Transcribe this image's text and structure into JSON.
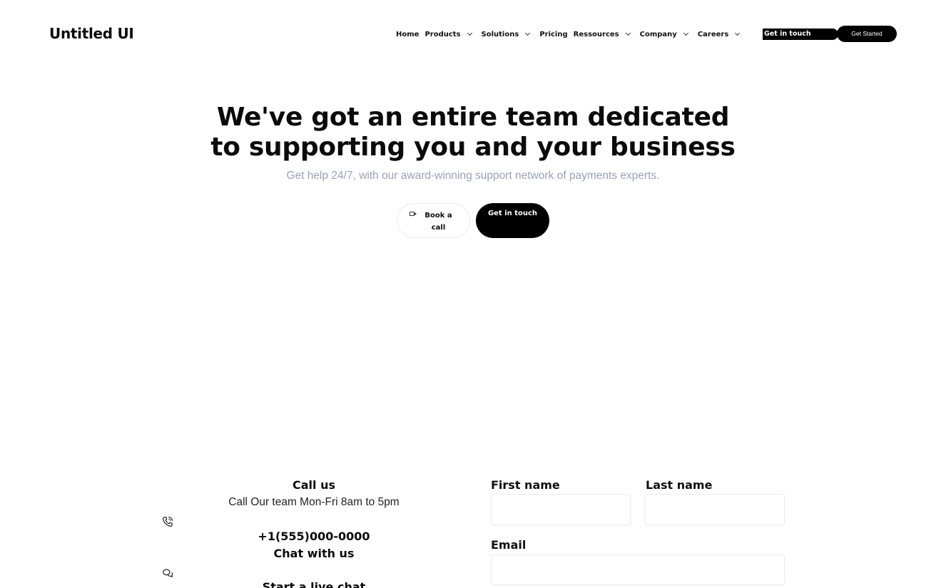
{
  "brand": {
    "name": "Untitled UI"
  },
  "nav": {
    "items": [
      {
        "label": "Home",
        "dropdown": false
      },
      {
        "label": "Products",
        "dropdown": true
      },
      {
        "label": "Solutions",
        "dropdown": true
      },
      {
        "label": "Pricing",
        "dropdown": false
      },
      {
        "label": "Ressources",
        "dropdown": true
      },
      {
        "label": "Company",
        "dropdown": true
      },
      {
        "label": "Careers",
        "dropdown": true
      }
    ],
    "get_in_touch": "Get in touch",
    "get_started": "Get Started"
  },
  "hero": {
    "title_line1": "We've got an entire team dedicated",
    "title_line2": "to supporting you and your business",
    "subtitle": "Get help 24/7, with our award-winning support network of payments experts.",
    "book_call_line1": "Book a",
    "book_call_line2": "call",
    "get_in_touch": "Get in touch"
  },
  "contact": {
    "call_heading": "Call us",
    "call_text": "Call Our team Mon-Fri 8am to 5pm",
    "phone": "+1(555)000-0000",
    "chat_heading": "Chat with us",
    "chat_text": "Start a live chat"
  },
  "form": {
    "first_name_label": "First name",
    "first_name_value": "",
    "last_name_label": "Last name",
    "last_name_value": "",
    "email_label": "Email",
    "email_value": ""
  },
  "icons": {
    "phone": "phone-icon",
    "chat": "chat-icon",
    "video": "video-icon",
    "chevron": "chevron-down-icon"
  }
}
